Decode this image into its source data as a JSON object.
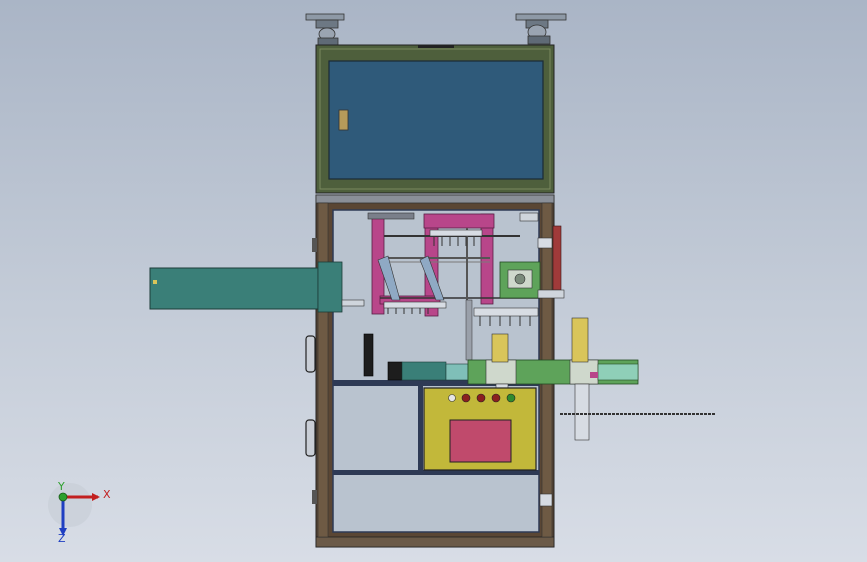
{
  "viewport": {
    "background_top": "#aab5c6",
    "background_bottom": "#d8dde6"
  },
  "colors": {
    "cabinet_frame": "#4e5f3c",
    "glass_panel": "#2f5a7a",
    "steel_frame": "#5a4634",
    "inner_panel": "#b9c3cf",
    "control_box": "#c2b83a",
    "control_screen": "#c04a6c",
    "teal_part": "#3a7f78",
    "magenta_part": "#b8468a",
    "green_part": "#5ea35a",
    "red_button": "#8a1f1f",
    "green_button": "#2e8a2e"
  },
  "axis_triad": {
    "x_label": "X",
    "y_label": "Y",
    "z_label": "Z"
  }
}
